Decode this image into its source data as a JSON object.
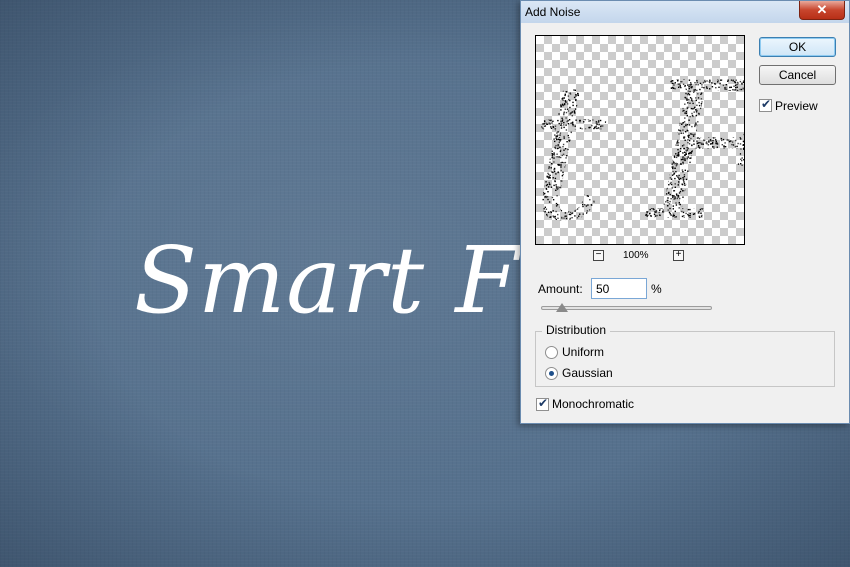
{
  "canvas": {
    "text": "Smart Fi",
    "background_color": "#56718d",
    "text_color": "#ffffff"
  },
  "dialog": {
    "title": "Add Noise",
    "close_label": "✕",
    "ok_label": "OK",
    "cancel_label": "Cancel",
    "preview_label": "Preview",
    "preview_checked": true,
    "preview_letters": "tF",
    "zoom": {
      "minus_label": "−",
      "level": "100%",
      "plus_label": "+"
    },
    "amount": {
      "label": "Amount:",
      "value": "50",
      "unit": "%",
      "slider_fraction": 0.125
    },
    "distribution": {
      "legend": "Distribution",
      "options": [
        "Uniform",
        "Gaussian"
      ],
      "selected": "Gaussian"
    },
    "monochromatic_label": "Monochromatic",
    "monochromatic_checked": true
  }
}
